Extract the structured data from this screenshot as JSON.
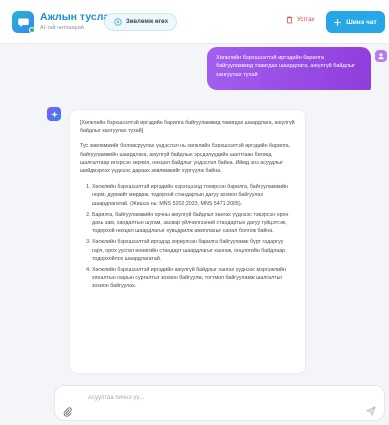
{
  "header": {
    "title": "Ажлын туслах",
    "status": "AI-тай чатлаарай",
    "guide_label": "Зөвлөмж өгөх",
    "delete_label": "Устгах",
    "new_chat_label": "Шинэ чат"
  },
  "colors": {
    "brand": "#1b8fd6",
    "new_chat_button": "#27a7e6",
    "user_bubble": "#9b51e8",
    "delete": "#e03e3e",
    "online": "#22c55e"
  },
  "icons": {
    "logo": "chat-bubble-icon",
    "guide": "sparkle-icon",
    "delete": "trash-icon",
    "new_chat": "plus-icon",
    "user": "user-icon",
    "bot": "bot-icon",
    "attach": "paperclip-icon",
    "send": "send-icon"
  },
  "messages": {
    "user": {
      "text": "Хөгжлийн бэрхшээлтэй иргэдийн барилга байгууламжид тавигдах шаардлага, аюулгүй байдлыг хангуулах тухай"
    },
    "bot": {
      "quote": "[Хөгжлийн бэрхшээлтэй иргэдийн барилга байгууламжид тавигдах шаардлага, аюулгүй байдлыг хангуулах тухай]",
      "intro": "Тус зөвлөмжийг боловсруулах үндэслэл нь хөгжлийн бэрхшээлтэй иргэдийн барилга, байгууламжийн шаардлага, аюулгүй байдлын эрсдэлүүдийн шалтгаан бөгөөд шалгалтаар илэрсэн зөрчил, нөхцөл байдлыг үндэслэл байна. Иймд энэ асуудлыг шийдвэрлэх үүднээс дараах зөвлөмжийг хүргүүлж байна.",
      "items": [
        "Хөгжлийн бэрхшээлтэй иргэдийн хэрэгцээнд тохирсон барилга, байгууламжийн норм, дүрмийг мөрдөж, тодорхой стандартын дагуу зохион байгуулах шаардлагатай. (Жишээ нь: MNS 5202:2023, MNS 5471:2005).",
        "Барилга, байгууламжийн орчны аюулгүй байдлыг хангах үүднээс тэвэрсэн орон дахь зам, хандалтын шугам, засвар үйлчилгээний стандартын дагуу гүйцэтгэж, тодорхой нөхцөл шаардлагыг хувьдрилж ажиллахыг санал болгож байна.",
        "Хөгжлийн бэрхшээлтэй иргэдэд зориулсан барилга байгууламж бүрт гадаргуу гарч, орох уусгал өнөөгийн стандарт шаардлагыг хангаж, онцлогийн байдлаар тодорхойлох шаардлагатай.",
        "Хөгжлийн бэрхшээлтэй иргэдийн аюулгүй байдлыг хангах үүднээс мэргэжлийн хяналтын газрын сургалтыг зохион байгуулж, тогтмол байгууламж шалгалтыг зохион байгуулах."
      ]
    }
  },
  "composer": {
    "placeholder": "Асуултаа бичнэ үү..."
  }
}
